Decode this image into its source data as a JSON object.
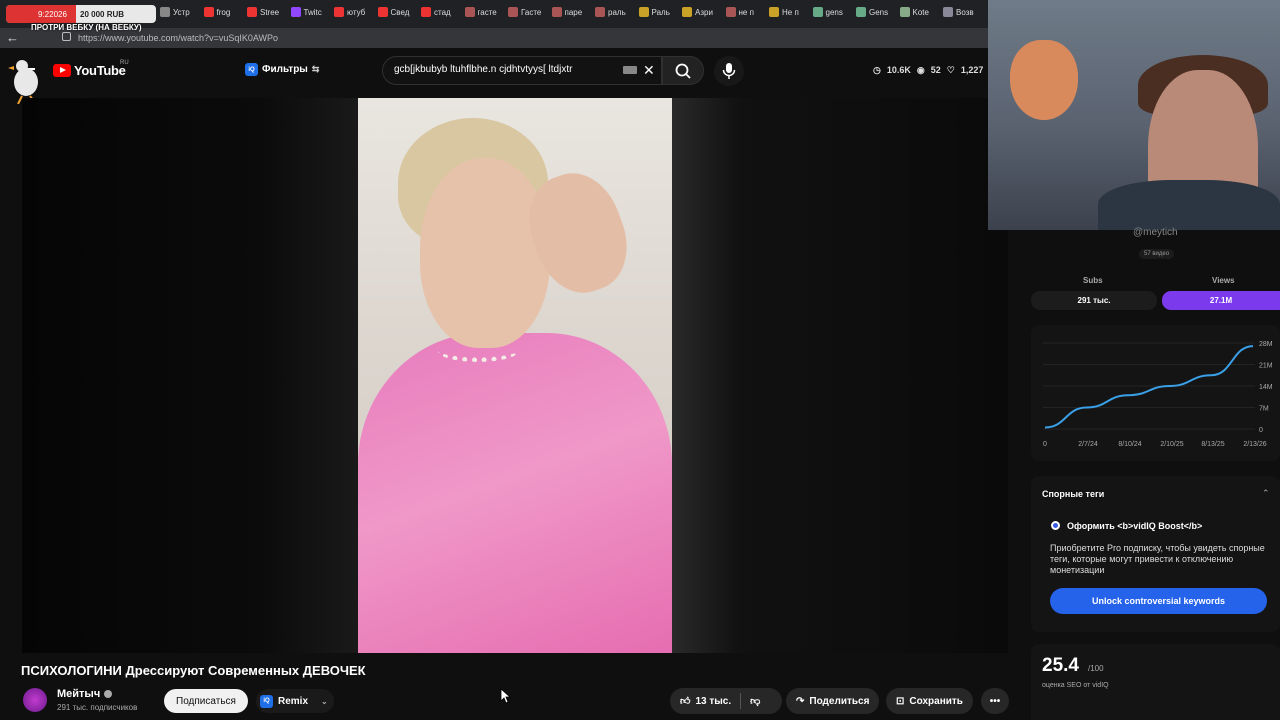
{
  "browser": {
    "donation": {
      "time": "9:22026",
      "amount": "20 000 RUB"
    },
    "tabs": [
      "Устр",
      "frog",
      "Stree",
      "Twitc",
      "ютуб",
      "Свед",
      "стад",
      "гасте",
      "Гасте",
      "паре",
      "раль",
      "Раль",
      "Азри",
      "не п",
      "Не п",
      "gens",
      "Gens",
      "Kote",
      "Возв"
    ],
    "overlay_label": "ПРОТРИ ВЕБКУ (НА ВЕБКУ)",
    "url": "https://www.youtube.com/watch?v=vuSqIK0AWPo"
  },
  "header": {
    "logo_text": "YouTube",
    "country": "RU",
    "filters_label": "Фильтры",
    "iq_badge": "iQ",
    "search_value": "gcb[jkbubyb ltuhflbhe.n cjdhtvtyys[ ltdjxtr",
    "stats": [
      "10.6K",
      "52",
      "1,227"
    ]
  },
  "video": {
    "title": "ПСИХОЛОГИНИ Дрессируют Современных ДЕВОЧЕК",
    "channel_name": "Мейтыч",
    "subscribers": "291 тыс. подписчиков",
    "subscribe_label": "Подписаться",
    "remix_label": "Remix",
    "likes": "13 тыс.",
    "share_label": "Поделиться",
    "save_label": "Сохранить"
  },
  "sidebar": {
    "handle": "@meytich",
    "video_count": "57 видео",
    "subs_label": "Subs",
    "views_label": "Views",
    "subs_value": "291 тыс.",
    "views_value": "27.1M",
    "tags_title": "Спорные теги",
    "boost_title": "Оформить <b>vidIQ Boost</b>",
    "boost_desc": "Приобретите Pro подписку, чтобы увидеть спорные теги, которые могут привести к отключению монетизации",
    "unlock_label": "Unlock controversial keywords",
    "seo_score": "25.4",
    "seo_max": "/100",
    "seo_label": "оценка SEO от vidIQ"
  },
  "chart_data": {
    "type": "line",
    "x": [
      "0",
      "2/7/24",
      "8/10/24",
      "2/10/25",
      "8/13/25",
      "2/13/26"
    ],
    "y_ticks": [
      "28M",
      "21M",
      "14M",
      "7M",
      "0"
    ],
    "series": [
      {
        "values": [
          0.5,
          7,
          11,
          14,
          17.5,
          27
        ]
      }
    ],
    "ylim": [
      0,
      28
    ]
  }
}
